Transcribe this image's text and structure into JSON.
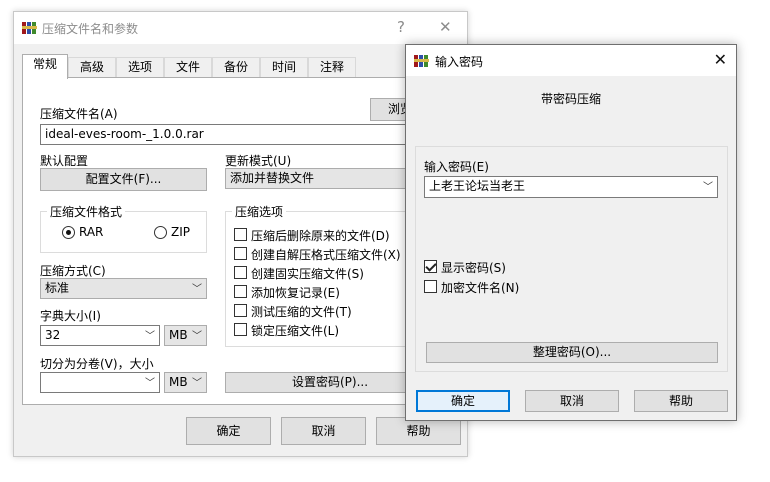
{
  "back_dialog": {
    "title": "压缩文件名和参数",
    "help_glyph": "?",
    "close_glyph": "✕",
    "tabs": [
      {
        "label": "常规",
        "active": true
      },
      {
        "label": "高级"
      },
      {
        "label": "选项"
      },
      {
        "label": "文件"
      },
      {
        "label": "备份"
      },
      {
        "label": "时间"
      },
      {
        "label": "注释"
      }
    ],
    "archive_name_label": "压缩文件名(A)",
    "archive_name_value": "ideal-eves-room-_1.0.0.rar",
    "browse_label": "浏览",
    "default_profile_label": "默认配置",
    "profiles_button": "配置文件(F)...",
    "update_mode_label": "更新模式(U)",
    "update_mode_value": "添加并替换文件",
    "format_group_label": "压缩文件格式",
    "format_rar": "RAR",
    "format_zip": "ZIP",
    "options_group_label": "压缩选项",
    "options": [
      {
        "label": "压缩后删除原来的文件(D)",
        "checked": false
      },
      {
        "label": "创建自解压格式压缩文件(X)",
        "checked": false
      },
      {
        "label": "创建固实压缩文件(S)",
        "checked": false
      },
      {
        "label": "添加恢复记录(E)",
        "checked": false
      },
      {
        "label": "测试压缩的文件(T)",
        "checked": false
      },
      {
        "label": "锁定压缩文件(L)",
        "checked": false
      }
    ],
    "method_label": "压缩方式(C)",
    "method_value": "标准",
    "dict_label": "字典大小(I)",
    "dict_value": "32",
    "dict_unit": "MB",
    "split_label": "切分为分卷(V)，大小",
    "split_value": "",
    "split_unit": "MB",
    "set_password_button": "设置密码(P)...",
    "ok": "确定",
    "cancel": "取消",
    "help": "帮助"
  },
  "password_dialog": {
    "title": "输入密码",
    "close_glyph": "✕",
    "heading": "带密码压缩",
    "enter_password_label": "输入密码(E)",
    "password_value": "上老王论坛当老王",
    "show_password_label": "显示密码(S)",
    "show_password_checked": true,
    "encrypt_names_label": "加密文件名(N)",
    "encrypt_names_checked": false,
    "organize_button": "整理密码(O)...",
    "ok": "确定",
    "cancel": "取消",
    "help": "帮助"
  },
  "icons": {
    "app": "winrar-books-icon",
    "dropdown": "chevron-down-icon"
  },
  "colors": {
    "dialog_bg": "#f0f0f0",
    "button_bg": "#e1e1e1",
    "focus_border": "#0078d7",
    "inactive_title": "#8c8c8c"
  }
}
